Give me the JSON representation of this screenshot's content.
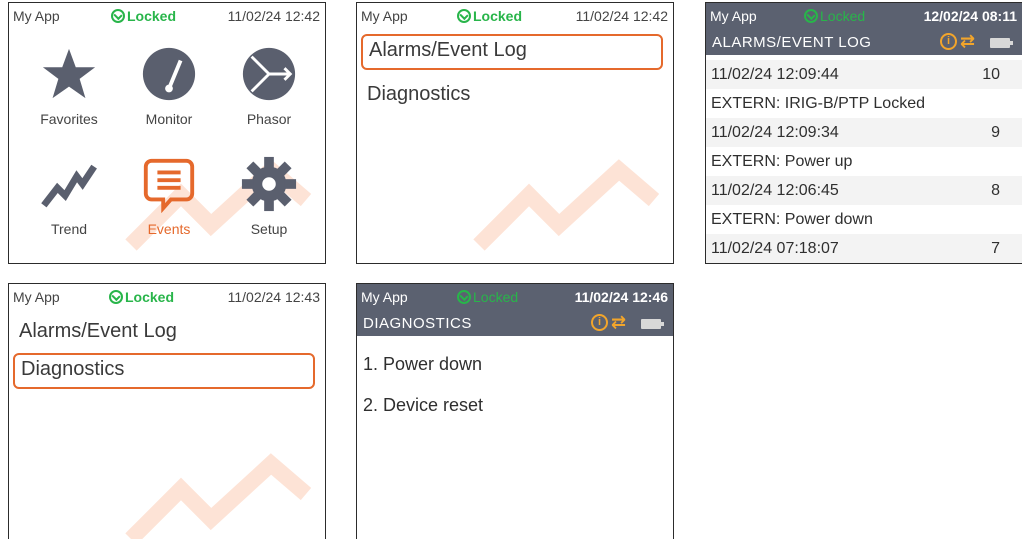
{
  "status": {
    "app": "My App",
    "lock": "Locked"
  },
  "times": {
    "s1": "11/02/24 12:42",
    "s2": "11/02/24 12:42",
    "s3": "12/02/24 08:11",
    "s4": "11/02/24 12:43",
    "s5": "11/02/24 12:46"
  },
  "home": {
    "items": [
      {
        "label": "Favorites",
        "icon": "star-icon"
      },
      {
        "label": "Monitor",
        "icon": "gauge-icon"
      },
      {
        "label": "Phasor",
        "icon": "phasor-icon"
      },
      {
        "label": "Trend",
        "icon": "trend-icon"
      },
      {
        "label": "Events",
        "icon": "events-icon",
        "active": true
      },
      {
        "label": "Setup",
        "icon": "gear-icon"
      }
    ]
  },
  "events_menu": {
    "item1": "Alarms/Event Log",
    "item2": "Diagnostics"
  },
  "log": {
    "title": "ALARMS/EVENT LOG",
    "rows": [
      {
        "text": "11/02/24 12:09:44",
        "num": "10"
      },
      {
        "text": "EXTERN: IRIG-B/PTP Locked",
        "num": ""
      },
      {
        "text": "11/02/24 12:09:34",
        "num": "9"
      },
      {
        "text": "EXTERN: Power up",
        "num": ""
      },
      {
        "text": "11/02/24 12:06:45",
        "num": "8"
      },
      {
        "text": "EXTERN: Power down",
        "num": ""
      },
      {
        "text": "11/02/24 07:18:07",
        "num": "7"
      }
    ]
  },
  "diagnostics": {
    "title": "DIAGNOSTICS",
    "items": [
      "1. Power down",
      "2. Device reset"
    ]
  },
  "colors": {
    "accent": "#e5692c",
    "locked": "#28b54a",
    "header": "#5b6170",
    "icon": "#5a5f6e",
    "warn": "#f2a52b"
  }
}
